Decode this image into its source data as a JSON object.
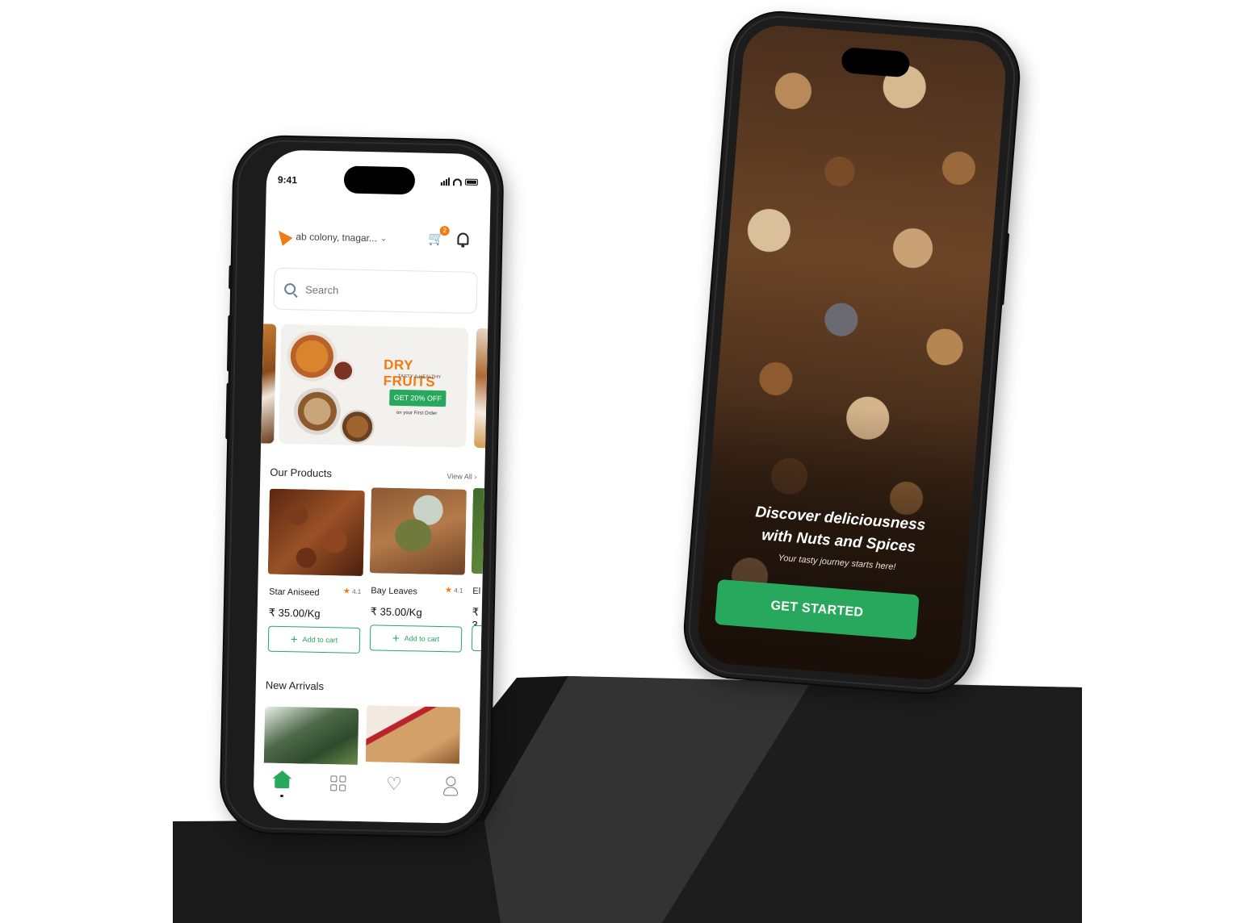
{
  "home_screen": {
    "status_time": "9:41",
    "location": "ab colony, tnagar...",
    "cart_count": "2",
    "search": {
      "placeholder": "Search"
    },
    "banner": {
      "title": "DRY FRUITS",
      "subtitle": "TASTY & HEALTHY",
      "cta": "GET 20% OFF",
      "note": "on your First Order"
    },
    "our_products": {
      "title": "Our Products",
      "view_all": "View All",
      "items": [
        {
          "name": "Star Aniseed",
          "rating": "4.1",
          "price": "₹ 35.00/Kg",
          "add_label": "Add to cart"
        },
        {
          "name": "Bay Leaves",
          "rating": "4.1",
          "price": "₹ 35.00/Kg",
          "add_label": "Add to cart"
        },
        {
          "name": "El",
          "price": "₹ 3"
        }
      ]
    },
    "new_arrivals": {
      "title": "New Arrivals"
    },
    "tabs": [
      "home",
      "categories",
      "wishlist",
      "profile"
    ]
  },
  "onboarding_screen": {
    "title_line1": "Discover deliciousness",
    "title_line2": "with Nuts and Spices",
    "subtitle": "Your tasty journey starts here!",
    "cta": "GET STARTED"
  },
  "colors": {
    "accent_green": "#27a85c",
    "accent_orange": "#f07b14",
    "phone_frame": "#1c1c1c",
    "pedestal": "#1f1f1f"
  }
}
